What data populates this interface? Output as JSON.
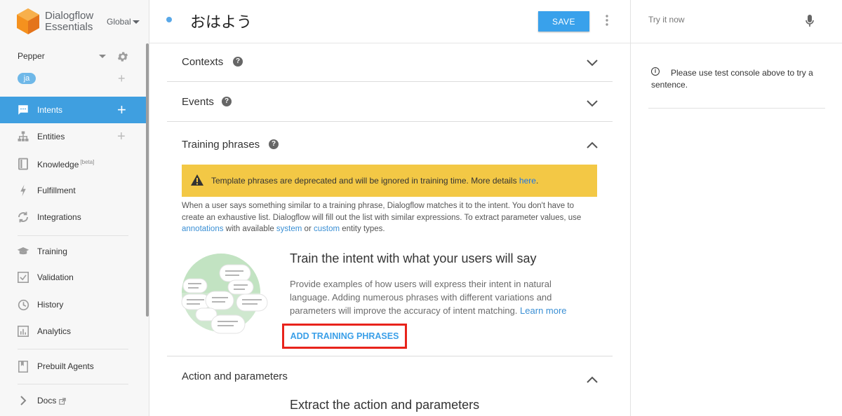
{
  "brand": {
    "line1": "Dialogflow",
    "line2": "Essentials",
    "region": "Global"
  },
  "agent": {
    "name": "Pepper",
    "language": "ja"
  },
  "sidebar": {
    "items": [
      {
        "label": "Intents",
        "icon": "chat-icon",
        "active": true,
        "plus": "+"
      },
      {
        "label": "Entities",
        "icon": "hierarchy-icon",
        "plus": "+"
      },
      {
        "label": "Knowledge",
        "badge": "[beta]",
        "icon": "book-icon"
      },
      {
        "label": "Fulfillment",
        "icon": "bolt-icon"
      },
      {
        "label": "Integrations",
        "icon": "sync-icon"
      },
      {
        "label": "Training",
        "icon": "graduation-cap-icon"
      },
      {
        "label": "Validation",
        "icon": "checkbox-icon"
      },
      {
        "label": "History",
        "icon": "clock-icon"
      },
      {
        "label": "Analytics",
        "icon": "bar-chart-icon"
      },
      {
        "label": "Prebuilt Agents",
        "icon": "bookmark-icon"
      },
      {
        "label": "Docs",
        "icon": "chevron-right-icon"
      }
    ]
  },
  "header": {
    "intent_name": "おはよう",
    "save_label": "SAVE"
  },
  "sections": {
    "contexts": {
      "title": "Contexts"
    },
    "events": {
      "title": "Events"
    },
    "training": {
      "title": "Training phrases",
      "warning_text": "Template phrases are deprecated and will be ignored in training time. More details",
      "warning_link": "here",
      "desc_1": "When a user says something similar to a training phrase, Dialogflow matches it to the intent. You don't have to create an exhaustive list. Dialogflow will fill out the list with similar expressions. To extract parameter values, use",
      "desc_link_annotations": "annotations",
      "desc_2": "with available",
      "desc_link_system": "system",
      "desc_3": "or",
      "desc_link_custom": "custom",
      "desc_4": "entity types.",
      "empty_title": "Train the intent with what your users will say",
      "empty_desc": "Provide examples of how users will express their intent in natural language. Adding numerous phrases with different variations and parameters will improve the accuracy of intent matching.",
      "learn_more": "Learn more",
      "add_button": "ADD TRAINING PHRASES"
    },
    "action": {
      "title": "Action and parameters",
      "empty_title": "Extract the action and parameters"
    }
  },
  "right_panel": {
    "try_placeholder": "Try it now",
    "info_text": "Please use test console above to try a sentence."
  },
  "colors": {
    "accent": "#39a1eb",
    "warning": "#f3c845",
    "highlight_border": "#e8231b"
  }
}
